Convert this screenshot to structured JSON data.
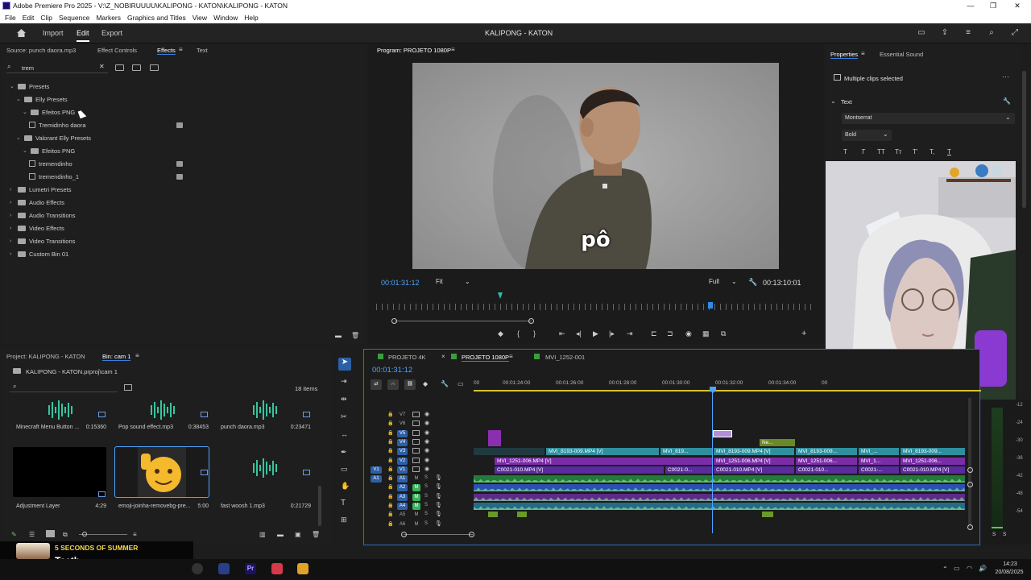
{
  "window": {
    "title": "Adobe Premiere Pro 2025 - V:\\Z_NOBIRUUUU\\KALIPONG - KATON\\KALIPONG - KATON"
  },
  "menu": [
    "File",
    "Edit",
    "Clip",
    "Sequence",
    "Markers",
    "Graphics and Titles",
    "View",
    "Window",
    "Help"
  ],
  "header": {
    "workspaces": [
      "Import",
      "Edit",
      "Export"
    ],
    "active": "Edit",
    "project_title": "KALIPONG - KATON"
  },
  "effects_panel": {
    "tabs": [
      "Source: punch daora.mp3",
      "Effect Controls",
      "Effects",
      "Text"
    ],
    "active_tab": "Effects",
    "search_value": "trem",
    "tree": [
      {
        "label": "Presets",
        "level": 0,
        "type": "folder",
        "open": true
      },
      {
        "label": "Elly Presets",
        "level": 1,
        "type": "folder",
        "open": true
      },
      {
        "label": "Efeitos PNG",
        "level": 2,
        "type": "folder",
        "open": true
      },
      {
        "label": "Tremidinho daora",
        "level": 3,
        "type": "preset",
        "badge": true
      },
      {
        "label": "Valorant Elly Presets",
        "level": 1,
        "type": "folder",
        "open": true
      },
      {
        "label": "Efeitos PNG",
        "level": 2,
        "type": "folder",
        "open": true
      },
      {
        "label": "tremendinho",
        "level": 3,
        "type": "preset",
        "badge": true
      },
      {
        "label": "tremendinho_1",
        "level": 3,
        "type": "preset",
        "badge": true
      },
      {
        "label": "Lumetri Presets",
        "level": 0,
        "type": "folder",
        "open": false
      },
      {
        "label": "Audio Effects",
        "level": 0,
        "type": "folder",
        "open": false
      },
      {
        "label": "Audio Transitions",
        "level": 0,
        "type": "folder",
        "open": false
      },
      {
        "label": "Video Effects",
        "level": 0,
        "type": "folder",
        "open": false
      },
      {
        "label": "Video Transitions",
        "level": 0,
        "type": "folder",
        "open": false
      },
      {
        "label": "Custom Bin 01",
        "level": 0,
        "type": "folder",
        "open": false
      }
    ]
  },
  "program_monitor": {
    "title": "Program: PROJETO 1080P",
    "caption": "pô",
    "timecode": "00:01:31:12",
    "fit": "Fit",
    "quality": "Full",
    "duration": "00:13:10:01"
  },
  "properties_panel": {
    "tabs": [
      "Properties",
      "Essential Sound"
    ],
    "active_tab": "Properties",
    "selection": "Multiple clips selected",
    "section": "Text",
    "font": "Montserrat",
    "style": "Bold",
    "text_buttons": [
      "T",
      "T",
      "TT",
      "Tт",
      "T'",
      "T,",
      "T"
    ]
  },
  "project_panel": {
    "tabs": [
      "Project: KALIPONG - KATON",
      "Bin: cam 1"
    ],
    "active_tab": "Bin: cam 1",
    "path": "KALIPONG - KATON.prproj\\cam 1",
    "items_count": "18 items",
    "items": [
      {
        "name": "Minecraft Menu Button ...",
        "duration": "0:15360",
        "kind": "audio"
      },
      {
        "name": "Pop sound effect.mp3",
        "duration": "0:38453",
        "kind": "audio"
      },
      {
        "name": "punch daora.mp3",
        "duration": "0:23471",
        "kind": "audio"
      },
      {
        "name": "Adjustment Layer",
        "duration": "4:29",
        "kind": "black"
      },
      {
        "name": "emoji-joinha-removebg-pre...",
        "duration": "5:00",
        "kind": "emoji"
      },
      {
        "name": "fast woosh 1.mp3",
        "duration": "0:21729",
        "kind": "audio"
      }
    ]
  },
  "timeline": {
    "tabs": [
      "PROJETO 4K",
      "PROJETO 1080P",
      "MVI_1252-001"
    ],
    "active_tab": "PROJETO 1080P",
    "timecode": "00:01:31:12",
    "ruler": [
      "00",
      "00:01:24:00",
      "00:01:26:00",
      "00:01:28:00",
      "00:01:30:00",
      "00:01:32:00",
      "00:01:34:00",
      "00"
    ],
    "video_tracks": [
      "V7",
      "V6",
      "V5",
      "V4",
      "V3",
      "V2",
      "V1"
    ],
    "audio_tracks": [
      "A1",
      "A2",
      "A3",
      "A4",
      "A5",
      "A6"
    ],
    "clips": {
      "v3": [
        "MVI_8193-009.MP4 [V]",
        "MVI_819...",
        "MVI_8193-009.MP4 [V]",
        "MVI_8193-009...",
        "MVI_...",
        "MVI_8193-009..."
      ],
      "v2": [
        "MVI_1251-006.MP4 [V]",
        "MVI_1251-006.MP4 [V]",
        "MVI_1251-006...",
        "MVI_1...",
        "MVI_1251-006..."
      ],
      "v1": [
        "C0021-010.MP4 [V]",
        "C0021-0...",
        "C0021-010.MP4 [V]",
        "C0021-010...",
        "C0021-...",
        "C0021-010.MP4 [V]"
      ],
      "v4_label": "Ne..."
    }
  },
  "meter": {
    "scale": [
      "-12",
      "-24",
      "-30",
      "-36",
      "-42",
      "-48",
      "-54"
    ],
    "solo": [
      "S",
      "S"
    ]
  },
  "now_playing": {
    "artist": "5 SECONDS OF SUMMER",
    "title": "Teeth"
  },
  "clock": {
    "time": "14:23",
    "date": "20/08/2025"
  },
  "colors": {
    "accent": "#2d8ceb",
    "v3": "#2f8f9e",
    "v2": "#7b2da8",
    "v1": "#5a2b9e",
    "audio": "#1f6b3a"
  }
}
